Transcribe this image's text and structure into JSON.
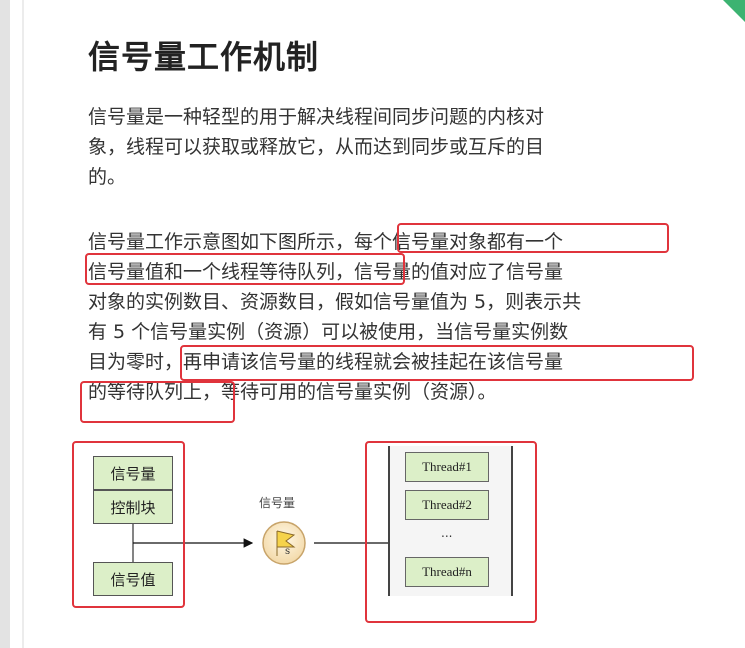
{
  "heading": "信号量工作机制",
  "para1": [
    "信号量是一种轻型的用于解决线程间同步问题的内核对",
    "象，线程可以获取或释放它，从而达到同步或互斥的目",
    "的。"
  ],
  "para2": [
    "信号量工作示意图如下图所示，每个信号量对象都有一个",
    "信号量值和一个线程等待队列，信号量的值对应了信号量",
    "对象的实例数目、资源数目，假如信号量值为 5，则表示共",
    "有 5 个信号量实例（资源）可以被使用，当信号量实例数",
    "目为零时，再申请该信号量的线程就会被挂起在该信号量",
    "的等待队列上，等待可用的信号量实例（资源）。"
  ],
  "diagram": {
    "control_block_top": "信号量",
    "control_block_bottom": "控制块",
    "value_box": "信号值",
    "semaphore_caption": "信号量",
    "semaphore_icon_letter": "s",
    "threads": [
      "Thread#1",
      "Thread#2",
      "Thread#n"
    ],
    "ellipsis": "..."
  },
  "colors": {
    "highlight_box": "#e0343c",
    "cell_fill": "#dcefc8",
    "corner_accent": "#3cb371"
  }
}
